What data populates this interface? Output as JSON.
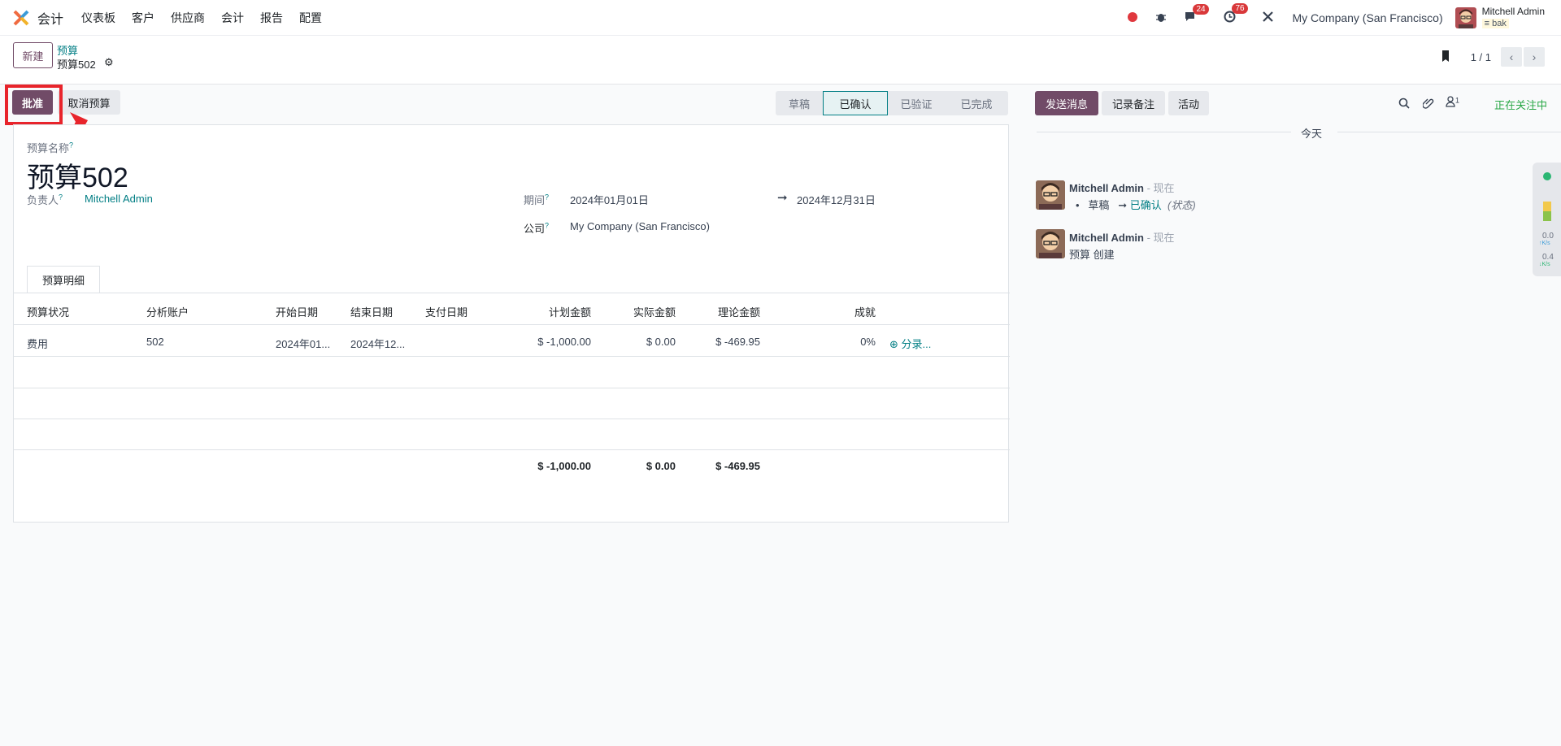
{
  "topbar": {
    "app_name": "会计",
    "menu": [
      "仪表板",
      "客户",
      "供应商",
      "会计",
      "报告",
      "配置"
    ],
    "messages_count": "24",
    "activities_count": "76",
    "company": "My Company (San Francisco)",
    "user_name": "Mitchell Admin",
    "db_name": "bak"
  },
  "control_panel": {
    "new_label": "新建",
    "breadcrumb_parent": "预算",
    "breadcrumb_current": "预算502",
    "pager_value": "1 / 1"
  },
  "form_actions": {
    "approve_label": "批准",
    "cancel_label": "取消预算"
  },
  "statusbar": {
    "stages": [
      "草稿",
      "已确认",
      "已验证",
      "已完成"
    ],
    "active": "已确认"
  },
  "form": {
    "name_label": "预算名称",
    "name_value": "预算502",
    "responsible_label": "负责人",
    "responsible_value": "Mitchell Admin",
    "period_label": "期间",
    "date_from": "2024年01月01日",
    "date_to": "2024年12月31日",
    "company_label": "公司",
    "company_value": "My Company (San Francisco)",
    "tab_label": "预算明细"
  },
  "table": {
    "headers": [
      "预算状况",
      "分析账户",
      "开始日期",
      "结束日期",
      "支付日期",
      "计划金额",
      "实际金额",
      "理论金额",
      "成就"
    ],
    "rows": [
      {
        "position": "费用",
        "account": "502",
        "start": "2024年01...",
        "end": "2024年12...",
        "paid": "",
        "planned": "$ -1,000.00",
        "practical": "$ 0.00",
        "theoretical": "$ -469.95",
        "achievement": "0%",
        "entries_link": "分录..."
      }
    ],
    "totals": {
      "planned": "$ -1,000.00",
      "practical": "$ 0.00",
      "theoretical": "$ -469.95"
    }
  },
  "chatter": {
    "send_message": "发送消息",
    "log_note": "记录备注",
    "activities": "活动",
    "followers_count": "1",
    "following": "正在关注中",
    "date_separator": "今天",
    "messages": [
      {
        "author": "Mitchell Admin",
        "time": "- 现在",
        "from_state": "草稿",
        "to_state": "已确认",
        "field": "(状态)"
      },
      {
        "author": "Mitchell Admin",
        "time": "- 现在",
        "body": "预算 创建"
      }
    ]
  },
  "side_widget": {
    "up": "0.0",
    "down": "0.4",
    "unit": "K/s"
  },
  "colors": {
    "primary": "#714b67",
    "link": "#017e84",
    "highlight": "#e8242b"
  }
}
